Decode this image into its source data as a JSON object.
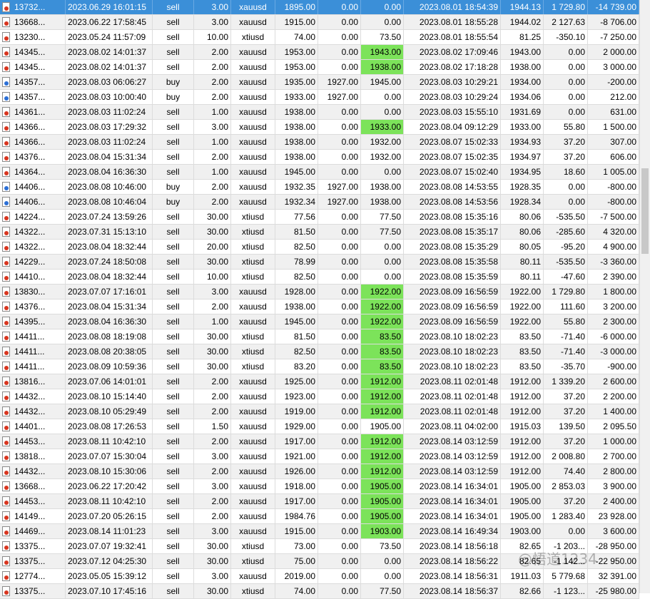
{
  "rows": [
    {
      "order": "13732...",
      "open_time": "2023.06.29 16:01:15",
      "type": "sell",
      "volume": "3.00",
      "symbol": "xauusd",
      "open_price": "1895.00",
      "sl": "0.00",
      "tp": "0.00",
      "close_time": "2023.08.01 18:54:39",
      "close_price": "1944.13",
      "swap": "1 729.80",
      "profit": "-14 739.00",
      "selected": true
    },
    {
      "order": "13668...",
      "open_time": "2023.06.22 17:58:45",
      "type": "sell",
      "volume": "3.00",
      "symbol": "xauusd",
      "open_price": "1915.00",
      "sl": "0.00",
      "tp": "0.00",
      "close_time": "2023.08.01 18:55:28",
      "close_price": "1944.02",
      "swap": "2 127.63",
      "profit": "-8 706.00"
    },
    {
      "order": "13230...",
      "open_time": "2023.05.24 11:57:09",
      "type": "sell",
      "volume": "10.00",
      "symbol": "xtiusd",
      "open_price": "74.00",
      "sl": "0.00",
      "tp": "73.50",
      "close_time": "2023.08.01 18:55:54",
      "close_price": "81.25",
      "swap": "-350.10",
      "profit": "-7 250.00"
    },
    {
      "order": "14345...",
      "open_time": "2023.08.02 14:01:37",
      "type": "sell",
      "volume": "2.00",
      "symbol": "xauusd",
      "open_price": "1953.00",
      "sl": "0.00",
      "tp": "1943.00",
      "tp_hl": true,
      "close_time": "2023.08.02 17:09:46",
      "close_price": "1943.00",
      "swap": "0.00",
      "profit": "2 000.00"
    },
    {
      "order": "14345...",
      "open_time": "2023.08.02 14:01:37",
      "type": "sell",
      "volume": "2.00",
      "symbol": "xauusd",
      "open_price": "1953.00",
      "sl": "0.00",
      "tp": "1938.00",
      "tp_hl": true,
      "close_time": "2023.08.02 17:18:28",
      "close_price": "1938.00",
      "swap": "0.00",
      "profit": "3 000.00"
    },
    {
      "order": "14357...",
      "open_time": "2023.08.03 06:06:27",
      "type": "buy",
      "volume": "2.00",
      "symbol": "xauusd",
      "open_price": "1935.00",
      "sl": "1927.00",
      "tp": "1945.00",
      "close_time": "2023.08.03 10:29:21",
      "close_price": "1934.00",
      "swap": "0.00",
      "profit": "-200.00"
    },
    {
      "order": "14357...",
      "open_time": "2023.08.03 10:00:40",
      "type": "buy",
      "volume": "2.00",
      "symbol": "xauusd",
      "open_price": "1933.00",
      "sl": "1927.00",
      "tp": "0.00",
      "close_time": "2023.08.03 10:29:24",
      "close_price": "1934.06",
      "swap": "0.00",
      "profit": "212.00"
    },
    {
      "order": "14361...",
      "open_time": "2023.08.03 11:02:24",
      "type": "sell",
      "volume": "1.00",
      "symbol": "xauusd",
      "open_price": "1938.00",
      "sl": "0.00",
      "tp": "0.00",
      "close_time": "2023.08.03 15:55:10",
      "close_price": "1931.69",
      "swap": "0.00",
      "profit": "631.00"
    },
    {
      "order": "14366...",
      "open_time": "2023.08.03 17:29:32",
      "type": "sell",
      "volume": "3.00",
      "symbol": "xauusd",
      "open_price": "1938.00",
      "sl": "0.00",
      "tp": "1933.00",
      "tp_hl": true,
      "close_time": "2023.08.04 09:12:29",
      "close_price": "1933.00",
      "swap": "55.80",
      "profit": "1 500.00"
    },
    {
      "order": "14366...",
      "open_time": "2023.08.03 11:02:24",
      "type": "sell",
      "volume": "1.00",
      "symbol": "xauusd",
      "open_price": "1938.00",
      "sl": "0.00",
      "tp": "1932.00",
      "close_time": "2023.08.07 15:02:33",
      "close_price": "1934.93",
      "swap": "37.20",
      "profit": "307.00"
    },
    {
      "order": "14376...",
      "open_time": "2023.08.04 15:31:34",
      "type": "sell",
      "volume": "2.00",
      "symbol": "xauusd",
      "open_price": "1938.00",
      "sl": "0.00",
      "tp": "1932.00",
      "close_time": "2023.08.07 15:02:35",
      "close_price": "1934.97",
      "swap": "37.20",
      "profit": "606.00"
    },
    {
      "order": "14364...",
      "open_time": "2023.08.04 16:36:30",
      "type": "sell",
      "volume": "1.00",
      "symbol": "xauusd",
      "open_price": "1945.00",
      "sl": "0.00",
      "tp": "0.00",
      "close_time": "2023.08.07 15:02:40",
      "close_price": "1934.95",
      "swap": "18.60",
      "profit": "1 005.00"
    },
    {
      "order": "14406...",
      "open_time": "2023.08.08 10:46:00",
      "type": "buy",
      "volume": "2.00",
      "symbol": "xauusd",
      "open_price": "1932.35",
      "sl": "1927.00",
      "tp": "1938.00",
      "close_time": "2023.08.08 14:53:55",
      "close_price": "1928.35",
      "swap": "0.00",
      "profit": "-800.00"
    },
    {
      "order": "14406...",
      "open_time": "2023.08.08 10:46:04",
      "type": "buy",
      "volume": "2.00",
      "symbol": "xauusd",
      "open_price": "1932.34",
      "sl": "1927.00",
      "tp": "1938.00",
      "close_time": "2023.08.08 14:53:56",
      "close_price": "1928.34",
      "swap": "0.00",
      "profit": "-800.00"
    },
    {
      "order": "14224...",
      "open_time": "2023.07.24 13:59:26",
      "type": "sell",
      "volume": "30.00",
      "symbol": "xtiusd",
      "open_price": "77.56",
      "sl": "0.00",
      "tp": "77.50",
      "close_time": "2023.08.08 15:35:16",
      "close_price": "80.06",
      "swap": "-535.50",
      "profit": "-7 500.00"
    },
    {
      "order": "14322...",
      "open_time": "2023.07.31 15:13:10",
      "type": "sell",
      "volume": "30.00",
      "symbol": "xtiusd",
      "open_price": "81.50",
      "sl": "0.00",
      "tp": "77.50",
      "close_time": "2023.08.08 15:35:17",
      "close_price": "80.06",
      "swap": "-285.60",
      "profit": "4 320.00"
    },
    {
      "order": "14322...",
      "open_time": "2023.08.04 18:32:44",
      "type": "sell",
      "volume": "20.00",
      "symbol": "xtiusd",
      "open_price": "82.50",
      "sl": "0.00",
      "tp": "0.00",
      "close_time": "2023.08.08 15:35:29",
      "close_price": "80.05",
      "swap": "-95.20",
      "profit": "4 900.00"
    },
    {
      "order": "14229...",
      "open_time": "2023.07.24 18:50:08",
      "type": "sell",
      "volume": "30.00",
      "symbol": "xtiusd",
      "open_price": "78.99",
      "sl": "0.00",
      "tp": "0.00",
      "close_time": "2023.08.08 15:35:58",
      "close_price": "80.11",
      "swap": "-535.50",
      "profit": "-3 360.00"
    },
    {
      "order": "14410...",
      "open_time": "2023.08.04 18:32:44",
      "type": "sell",
      "volume": "10.00",
      "symbol": "xtiusd",
      "open_price": "82.50",
      "sl": "0.00",
      "tp": "0.00",
      "close_time": "2023.08.08 15:35:59",
      "close_price": "80.11",
      "swap": "-47.60",
      "profit": "2 390.00"
    },
    {
      "order": "13830...",
      "open_time": "2023.07.07 17:16:01",
      "type": "sell",
      "volume": "3.00",
      "symbol": "xauusd",
      "open_price": "1928.00",
      "sl": "0.00",
      "tp": "1922.00",
      "tp_hl": true,
      "close_time": "2023.08.09 16:56:59",
      "close_price": "1922.00",
      "swap": "1 729.80",
      "profit": "1 800.00"
    },
    {
      "order": "14376...",
      "open_time": "2023.08.04 15:31:34",
      "type": "sell",
      "volume": "2.00",
      "symbol": "xauusd",
      "open_price": "1938.00",
      "sl": "0.00",
      "tp": "1922.00",
      "tp_hl": true,
      "close_time": "2023.08.09 16:56:59",
      "close_price": "1922.00",
      "swap": "111.60",
      "profit": "3 200.00"
    },
    {
      "order": "14395...",
      "open_time": "2023.08.04 16:36:30",
      "type": "sell",
      "volume": "1.00",
      "symbol": "xauusd",
      "open_price": "1945.00",
      "sl": "0.00",
      "tp": "1922.00",
      "tp_hl": true,
      "close_time": "2023.08.09 16:56:59",
      "close_price": "1922.00",
      "swap": "55.80",
      "profit": "2 300.00"
    },
    {
      "order": "14411...",
      "open_time": "2023.08.08 18:19:08",
      "type": "sell",
      "volume": "30.00",
      "symbol": "xtiusd",
      "open_price": "81.50",
      "sl": "0.00",
      "tp": "83.50",
      "tp_hl": true,
      "close_time": "2023.08.10 18:02:23",
      "close_price": "83.50",
      "swap": "-71.40",
      "profit": "-6 000.00"
    },
    {
      "order": "14411...",
      "open_time": "2023.08.08 20:38:05",
      "type": "sell",
      "volume": "30.00",
      "symbol": "xtiusd",
      "open_price": "82.50",
      "sl": "0.00",
      "tp": "83.50",
      "tp_hl": true,
      "close_time": "2023.08.10 18:02:23",
      "close_price": "83.50",
      "swap": "-71.40",
      "profit": "-3 000.00"
    },
    {
      "order": "14411...",
      "open_time": "2023.08.09 10:59:36",
      "type": "sell",
      "volume": "30.00",
      "symbol": "xtiusd",
      "open_price": "83.20",
      "sl": "0.00",
      "tp": "83.50",
      "tp_hl": true,
      "close_time": "2023.08.10 18:02:23",
      "close_price": "83.50",
      "swap": "-35.70",
      "profit": "-900.00"
    },
    {
      "order": "13816...",
      "open_time": "2023.07.06 14:01:01",
      "type": "sell",
      "volume": "2.00",
      "symbol": "xauusd",
      "open_price": "1925.00",
      "sl": "0.00",
      "tp": "1912.00",
      "tp_hl": true,
      "close_time": "2023.08.11 02:01:48",
      "close_price": "1912.00",
      "swap": "1 339.20",
      "profit": "2 600.00"
    },
    {
      "order": "14432...",
      "open_time": "2023.08.10 15:14:40",
      "type": "sell",
      "volume": "2.00",
      "symbol": "xauusd",
      "open_price": "1923.00",
      "sl": "0.00",
      "tp": "1912.00",
      "tp_hl": true,
      "close_time": "2023.08.11 02:01:48",
      "close_price": "1912.00",
      "swap": "37.20",
      "profit": "2 200.00"
    },
    {
      "order": "14432...",
      "open_time": "2023.08.10 05:29:49",
      "type": "sell",
      "volume": "2.00",
      "symbol": "xauusd",
      "open_price": "1919.00",
      "sl": "0.00",
      "tp": "1912.00",
      "tp_hl": true,
      "close_time": "2023.08.11 02:01:48",
      "close_price": "1912.00",
      "swap": "37.20",
      "profit": "1 400.00"
    },
    {
      "order": "14401...",
      "open_time": "2023.08.08 17:26:53",
      "type": "sell",
      "volume": "1.50",
      "symbol": "xauusd",
      "open_price": "1929.00",
      "sl": "0.00",
      "tp": "1905.00",
      "close_time": "2023.08.11 04:02:00",
      "close_price": "1915.03",
      "swap": "139.50",
      "profit": "2 095.50"
    },
    {
      "order": "14453...",
      "open_time": "2023.08.11 10:42:10",
      "type": "sell",
      "volume": "2.00",
      "symbol": "xauusd",
      "open_price": "1917.00",
      "sl": "0.00",
      "tp": "1912.00",
      "tp_hl": true,
      "close_time": "2023.08.14 03:12:59",
      "close_price": "1912.00",
      "swap": "37.20",
      "profit": "1 000.00"
    },
    {
      "order": "13818...",
      "open_time": "2023.07.07 15:30:04",
      "type": "sell",
      "volume": "3.00",
      "symbol": "xauusd",
      "open_price": "1921.00",
      "sl": "0.00",
      "tp": "1912.00",
      "tp_hl": true,
      "close_time": "2023.08.14 03:12:59",
      "close_price": "1912.00",
      "swap": "2 008.80",
      "profit": "2 700.00"
    },
    {
      "order": "14432...",
      "open_time": "2023.08.10 15:30:06",
      "type": "sell",
      "volume": "2.00",
      "symbol": "xauusd",
      "open_price": "1926.00",
      "sl": "0.00",
      "tp": "1912.00",
      "tp_hl": true,
      "close_time": "2023.08.14 03:12:59",
      "close_price": "1912.00",
      "swap": "74.40",
      "profit": "2 800.00"
    },
    {
      "order": "13668...",
      "open_time": "2023.06.22 17:20:42",
      "type": "sell",
      "volume": "3.00",
      "symbol": "xauusd",
      "open_price": "1918.00",
      "sl": "0.00",
      "tp": "1905.00",
      "tp_hl": true,
      "close_time": "2023.08.14 16:34:01",
      "close_price": "1905.00",
      "swap": "2 853.03",
      "profit": "3 900.00"
    },
    {
      "order": "14453...",
      "open_time": "2023.08.11 10:42:10",
      "type": "sell",
      "volume": "2.00",
      "symbol": "xauusd",
      "open_price": "1917.00",
      "sl": "0.00",
      "tp": "1905.00",
      "tp_hl": true,
      "close_time": "2023.08.14 16:34:01",
      "close_price": "1905.00",
      "swap": "37.20",
      "profit": "2 400.00"
    },
    {
      "order": "14149...",
      "open_time": "2023.07.20 05:26:15",
      "type": "sell",
      "volume": "2.00",
      "symbol": "xauusd",
      "open_price": "1984.76",
      "sl": "0.00",
      "tp": "1905.00",
      "tp_hl": true,
      "close_time": "2023.08.14 16:34:01",
      "close_price": "1905.00",
      "swap": "1 283.40",
      "profit": "23 928.00"
    },
    {
      "order": "14469...",
      "open_time": "2023.08.14 11:01:23",
      "type": "sell",
      "volume": "3.00",
      "symbol": "xauusd",
      "open_price": "1915.00",
      "sl": "0.00",
      "tp": "1903.00",
      "tp_hl": true,
      "close_time": "2023.08.14 16:49:34",
      "close_price": "1903.00",
      "swap": "0.00",
      "profit": "3 600.00"
    },
    {
      "order": "13375...",
      "open_time": "2023.07.07 19:32:41",
      "type": "sell",
      "volume": "30.00",
      "symbol": "xtiusd",
      "open_price": "73.00",
      "sl": "0.00",
      "tp": "73.50",
      "close_time": "2023.08.14 18:56:18",
      "close_price": "82.65",
      "swap": "-1 203...",
      "profit": "-28 950.00"
    },
    {
      "order": "13375...",
      "open_time": "2023.07.12 04:25:30",
      "type": "sell",
      "volume": "30.00",
      "symbol": "xtiusd",
      "open_price": "75.00",
      "sl": "0.00",
      "tp": "0.00",
      "close_time": "2023.08.14 18:56:22",
      "close_price": "82.65",
      "swap": "-1 142...",
      "profit": "-22 950.00"
    },
    {
      "order": "12774...",
      "open_time": "2023.05.05 15:39:12",
      "type": "sell",
      "volume": "3.00",
      "symbol": "xauusd",
      "open_price": "2019.00",
      "sl": "0.00",
      "tp": "0.00",
      "close_time": "2023.08.14 18:56:31",
      "close_price": "1911.03",
      "swap": "5 779.68",
      "profit": "32 391.00"
    },
    {
      "order": "13375...",
      "open_time": "2023.07.10 17:45:16",
      "type": "sell",
      "volume": "30.00",
      "symbol": "xtiusd",
      "open_price": "74.00",
      "sl": "0.00",
      "tp": "77.50",
      "close_time": "2023.08.14 18:56:37",
      "close_price": "82.66",
      "swap": "-1 123...",
      "profit": "-25 980.00"
    }
  ],
  "watermark": "@悟道1234",
  "colors": {
    "selected_row": "#3b8fd8",
    "tp_highlight": "#7ce35a",
    "sell_icon": "#d8351f",
    "buy_icon": "#2b6fd6"
  }
}
